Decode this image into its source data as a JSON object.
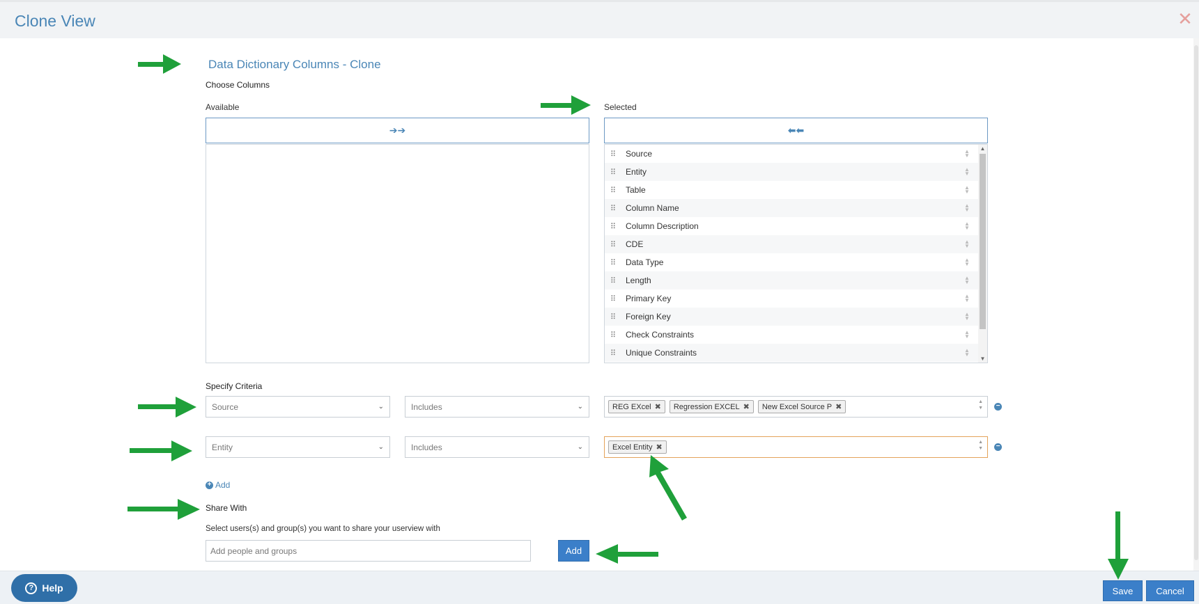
{
  "window": {
    "title": "Clone View"
  },
  "view_title": "Data Dictionary Columns - Clone",
  "choose_columns": {
    "heading": "Choose Columns",
    "available_label": "Available",
    "selected_label": "Selected",
    "move_right_glyph": "➔➔",
    "move_left_glyph": "⬅⬅",
    "selected_items": [
      "Source",
      "Entity",
      "Table",
      "Column Name",
      "Column Description",
      "CDE",
      "Data Type",
      "Length",
      "Primary Key",
      "Foreign Key",
      "Check Constraints",
      "Unique Constraints"
    ]
  },
  "criteria": {
    "heading": "Specify Criteria",
    "rows": [
      {
        "field": "Source",
        "operator": "Includes",
        "values": [
          "REG EXcel",
          "Regression EXCEL",
          "New Excel Source P"
        ]
      },
      {
        "field": "Entity",
        "operator": "Includes",
        "values": [
          "Excel Entity"
        ]
      }
    ],
    "add_label": "Add"
  },
  "share": {
    "heading": "Share With",
    "description": "Select users(s) and group(s) you want to share your userview with",
    "placeholder": "Add people and groups",
    "add_button": "Add"
  },
  "footer": {
    "help": "Help",
    "save": "Save",
    "cancel": "Cancel"
  },
  "colors": {
    "accent": "#4a86b6",
    "button": "#3b7fc9",
    "annotation_arrow": "#1fa03a"
  }
}
